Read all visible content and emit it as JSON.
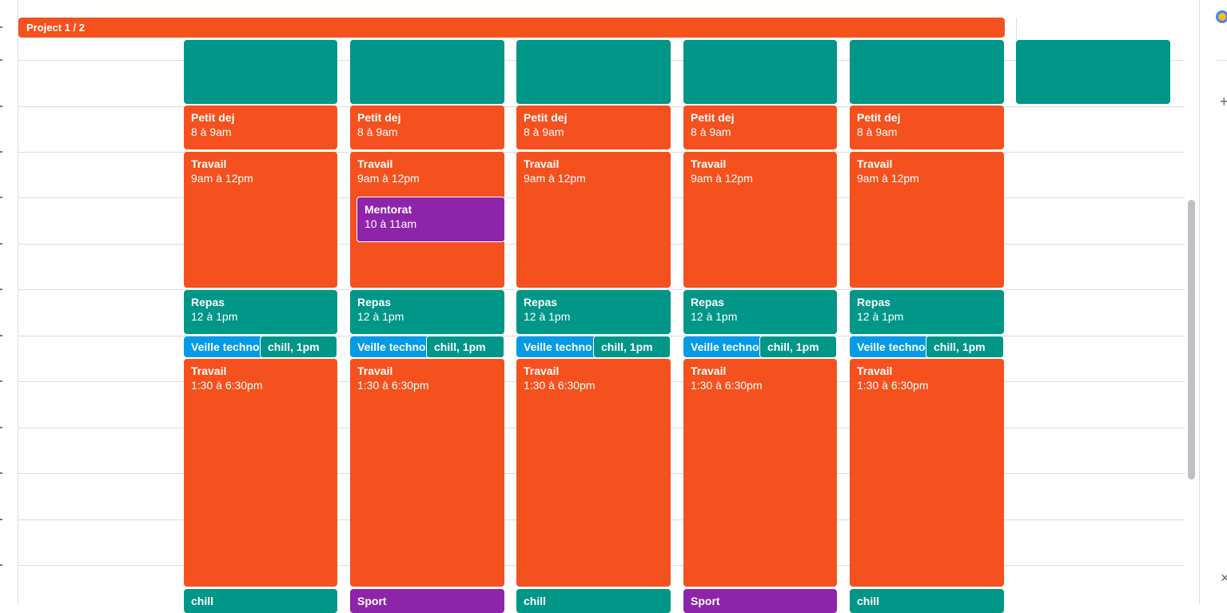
{
  "banner": {
    "label": "Project 1 / 2"
  },
  "colors": {
    "tangerine": "#f4511e",
    "basil": "#009688",
    "peacock": "#039be5",
    "grape": "#8e24aa"
  },
  "days": [
    {
      "events": {
        "petit_dej": {
          "title": "Petit dej",
          "time": "8 à 9am"
        },
        "travail_am": {
          "title": "Travail",
          "time": "9am à 12pm"
        },
        "repas": {
          "title": "Repas",
          "time": "12 à 1pm"
        },
        "veille": {
          "title": "Veille techno"
        },
        "chill_1pm": {
          "label": "chill, 1pm"
        },
        "travail_pm": {
          "title": "Travail",
          "time": "1:30 à 6:30pm"
        },
        "evening": {
          "title": "chill"
        }
      }
    },
    {
      "events": {
        "petit_dej": {
          "title": "Petit dej",
          "time": "8 à 9am"
        },
        "travail_am": {
          "title": "Travail",
          "time": "9am à 12pm"
        },
        "mentorat": {
          "title": "Mentorat",
          "time": "10 à 11am"
        },
        "repas": {
          "title": "Repas",
          "time": "12 à 1pm"
        },
        "veille": {
          "title": "Veille techno"
        },
        "chill_1pm": {
          "label": "chill, 1pm"
        },
        "travail_pm": {
          "title": "Travail",
          "time": "1:30 à 6:30pm"
        },
        "evening": {
          "title": "Sport"
        }
      }
    },
    {
      "events": {
        "petit_dej": {
          "title": "Petit dej",
          "time": "8 à 9am"
        },
        "travail_am": {
          "title": "Travail",
          "time": "9am à 12pm"
        },
        "repas": {
          "title": "Repas",
          "time": "12 à 1pm"
        },
        "veille": {
          "title": "Veille techno"
        },
        "chill_1pm": {
          "label": "chill, 1pm"
        },
        "travail_pm": {
          "title": "Travail",
          "time": "1:30 à 6:30pm"
        },
        "evening": {
          "title": "chill"
        }
      }
    },
    {
      "events": {
        "petit_dej": {
          "title": "Petit dej",
          "time": "8 à 9am"
        },
        "travail_am": {
          "title": "Travail",
          "time": "9am à 12pm"
        },
        "repas": {
          "title": "Repas",
          "time": "12 à 1pm"
        },
        "veille": {
          "title": "Veille techno"
        },
        "chill_1pm": {
          "label": "chill, 1pm"
        },
        "travail_pm": {
          "title": "Travail",
          "time": "1:30 à 6:30pm"
        },
        "evening": {
          "title": "Sport"
        }
      }
    },
    {
      "events": {
        "petit_dej": {
          "title": "Petit dej",
          "time": "8 à 9am"
        },
        "travail_am": {
          "title": "Travail",
          "time": "9am à 12pm"
        },
        "repas": {
          "title": "Repas",
          "time": "12 à 1pm"
        },
        "veille": {
          "title": "Veille techno"
        },
        "chill_1pm": {
          "label": "chill, 1pm"
        },
        "travail_pm": {
          "title": "Travail",
          "time": "1:30 à 6:30pm"
        },
        "evening": {
          "title": "chill"
        }
      }
    }
  ],
  "side_panel": {
    "add_icon": "plus-icon",
    "close_icon": "close-icon",
    "app_icon": "keep-icon"
  }
}
